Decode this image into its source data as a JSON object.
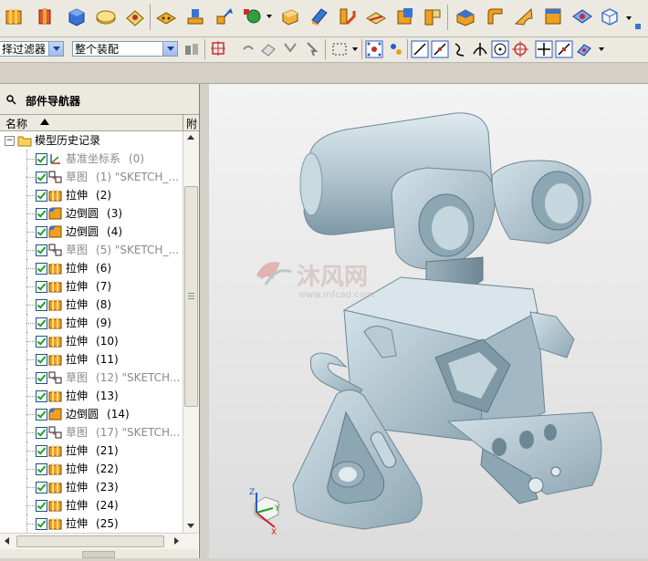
{
  "toolbar2": {
    "filter_label": "择过滤器",
    "scope_label": "整个装配"
  },
  "navigator": {
    "title": "部件导航器",
    "col_name": "名称",
    "col_attach": "附",
    "root": "模型历史记录",
    "rows": [
      {
        "label": "基准坐标系",
        "num": "(0)",
        "icon": "datum-csys-icon",
        "gray": true
      },
      {
        "label": "草图",
        "num": "(1) \"SKETCH_...",
        "icon": "sketch-icon",
        "gray": true
      },
      {
        "label": "拉伸",
        "num": "(2)",
        "icon": "extrude-icon",
        "gray": false
      },
      {
        "label": "边倒圆",
        "num": "(3)",
        "icon": "edge-blend-icon",
        "gray": false
      },
      {
        "label": "边倒圆",
        "num": "(4)",
        "icon": "edge-blend-icon",
        "gray": false
      },
      {
        "label": "草图",
        "num": "(5) \"SKETCH_...",
        "icon": "sketch-icon",
        "gray": true
      },
      {
        "label": "拉伸",
        "num": "(6)",
        "icon": "extrude-icon",
        "gray": false
      },
      {
        "label": "拉伸",
        "num": "(7)",
        "icon": "extrude-icon",
        "gray": false
      },
      {
        "label": "拉伸",
        "num": "(8)",
        "icon": "extrude-icon",
        "gray": false
      },
      {
        "label": "拉伸",
        "num": "(9)",
        "icon": "extrude-icon",
        "gray": false
      },
      {
        "label": "拉伸",
        "num": "(10)",
        "icon": "extrude-icon",
        "gray": false
      },
      {
        "label": "拉伸",
        "num": "(11)",
        "icon": "extrude-icon",
        "gray": false
      },
      {
        "label": "草图",
        "num": "(12) \"SKETCH...",
        "icon": "sketch-icon",
        "gray": true
      },
      {
        "label": "拉伸",
        "num": "(13)",
        "icon": "extrude-icon",
        "gray": false
      },
      {
        "label": "边倒圆",
        "num": "(14)",
        "icon": "edge-blend-icon",
        "gray": false
      },
      {
        "label": "草图",
        "num": "(17) \"SKETCH...",
        "icon": "sketch-icon",
        "gray": true
      },
      {
        "label": "拉伸",
        "num": "(21)",
        "icon": "extrude-icon",
        "gray": false
      },
      {
        "label": "拉伸",
        "num": "(22)",
        "icon": "extrude-icon",
        "gray": false
      },
      {
        "label": "拉伸",
        "num": "(23)",
        "icon": "extrude-icon",
        "gray": false
      },
      {
        "label": "拉伸",
        "num": "(24)",
        "icon": "extrude-icon",
        "gray": false
      },
      {
        "label": "拉伸",
        "num": "(25)",
        "icon": "extrude-icon",
        "gray": false
      }
    ]
  },
  "viewport": {
    "watermark_text": "沐风网",
    "watermark_url": "www.mfcad.com",
    "axis_x": "X",
    "axis_y": "Y",
    "axis_z": "Z"
  },
  "colors": {
    "model_fill": "#b9ccd6",
    "model_shadow": "#8aa3b1",
    "accent_blue": "#2a5ac4",
    "check_green": "#21a121"
  }
}
